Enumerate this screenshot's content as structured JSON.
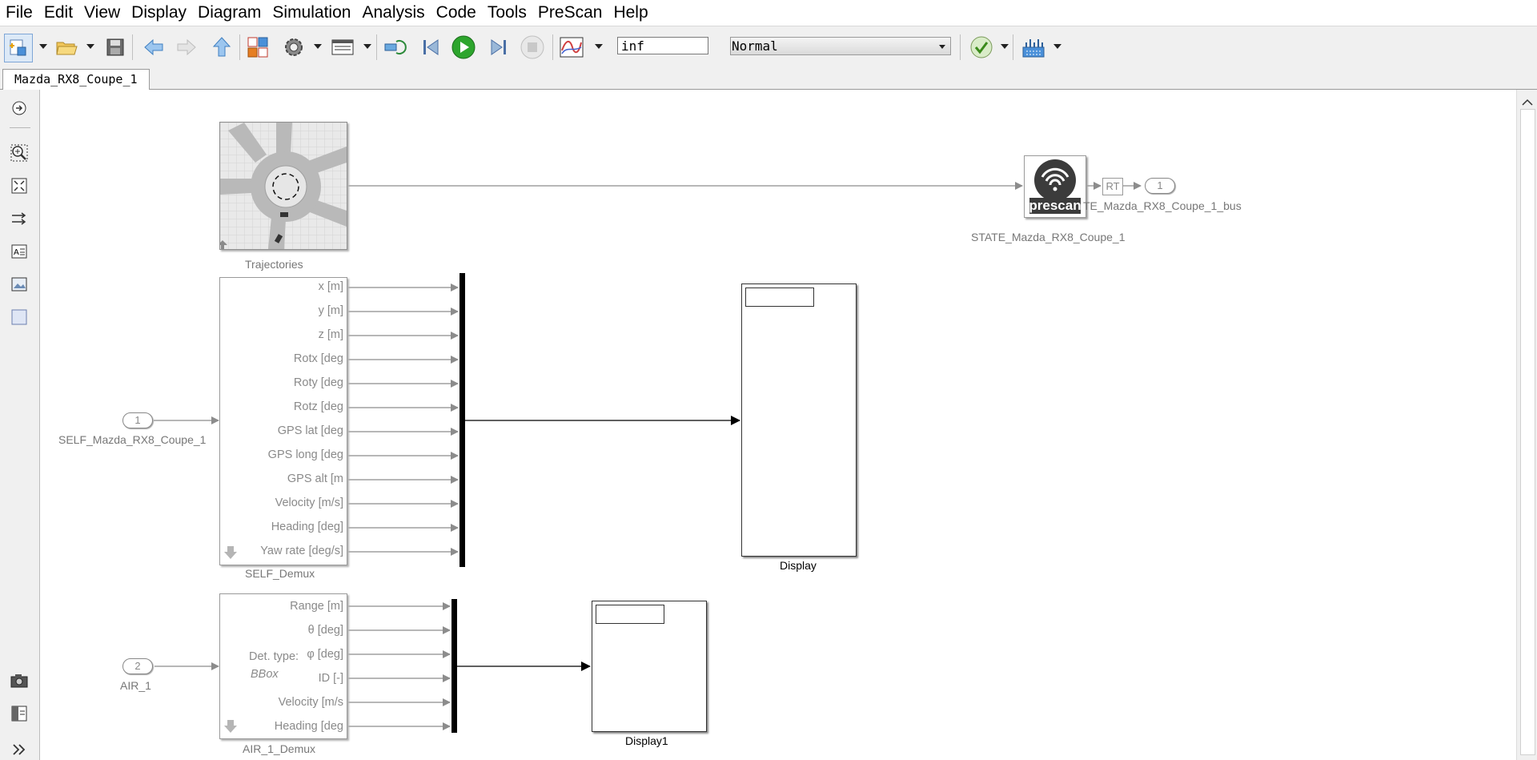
{
  "menu": [
    "File",
    "Edit",
    "View",
    "Display",
    "Diagram",
    "Simulation",
    "Analysis",
    "Code",
    "Tools",
    "PreScan",
    "Help"
  ],
  "toolbar": {
    "stop_time": "inf",
    "sim_mode": "Normal"
  },
  "tab": {
    "label": "Mazda_RX8_Coupe_1"
  },
  "blocks": {
    "trajectories": "Trajectories",
    "state_block": "STATE_Mazda_RX8_Coupe_1",
    "state_bus": "STATE_Mazda_RX8_Coupe_1_bus",
    "state_bus_visible": "TE_Mazda_RX8_Coupe_1_bus",
    "prescan_logo": "prescan",
    "rt_label": "RT",
    "outport1_num": "1",
    "inport1_num": "1",
    "inport1_label": "SELF_Mazda_RX8_Coupe_1",
    "inport2_num": "2",
    "inport2_label": "AIR_1",
    "self_demux": "SELF_Demux",
    "air_demux": "AIR_1_Demux",
    "display": "Display",
    "display1": "Display1",
    "det_type_label": "Det. type:",
    "det_type_value": "BBox"
  },
  "self_ports": [
    "x [m]",
    "y [m]",
    "z [m]",
    "Rotx [deg",
    "Roty [deg",
    "Rotz [deg",
    "GPS lat [deg",
    "GPS long [deg",
    "GPS alt [m",
    "Velocity [m/s]",
    "Heading [deg]",
    "Yaw rate [deg/s]"
  ],
  "air_ports": [
    "Range [m]",
    "θ [deg]",
    "φ [deg]",
    "ID [-]",
    "Velocity [m/s",
    "Heading [deg"
  ],
  "icons": [
    "new-model-icon",
    "open-icon",
    "save-icon",
    "back-icon",
    "forward-icon",
    "up-icon",
    "library-browser-icon",
    "model-settings-icon",
    "model-explorer-icon",
    "update-diagram-icon",
    "step-back-icon",
    "run-icon",
    "step-forward-icon",
    "stop-icon",
    "scope-icon",
    "check-icon",
    "build-icon"
  ],
  "colors": {
    "run_green": "#2da52d",
    "line_gray": "#8c8c8c",
    "block_border": "#9a9a9a"
  }
}
